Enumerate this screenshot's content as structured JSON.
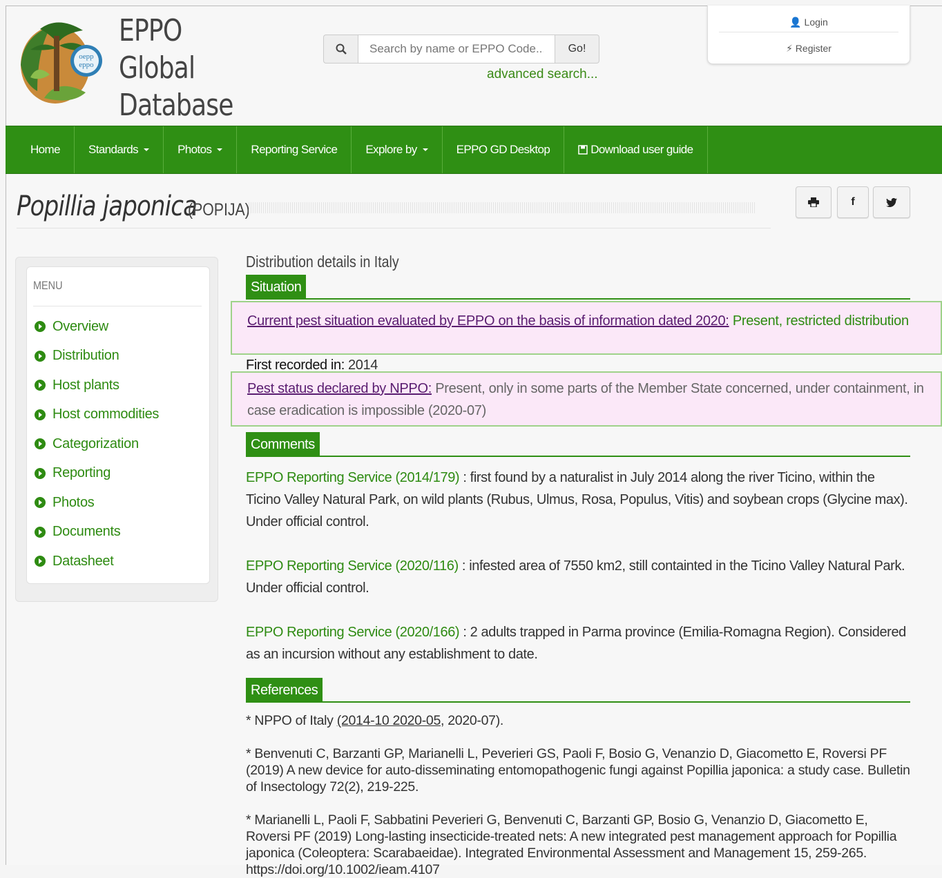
{
  "brand": {
    "line1": "EPPO",
    "line2": "Global",
    "line3": "Database",
    "logo_text_top": "oepp",
    "logo_text_bottom": "eppo"
  },
  "search": {
    "placeholder": "Search by name or EPPO Code...",
    "go_label": "Go!",
    "advanced_label": "advanced search..."
  },
  "user": {
    "login_label": "Login",
    "register_label": "Register"
  },
  "nav": [
    {
      "label": "Home",
      "dropdown": false
    },
    {
      "label": "Standards",
      "dropdown": true
    },
    {
      "label": "Photos",
      "dropdown": true
    },
    {
      "label": "Reporting Service",
      "dropdown": false
    },
    {
      "label": "Explore by",
      "dropdown": true
    },
    {
      "label": "EPPO GD Desktop",
      "dropdown": false
    },
    {
      "label": "Download user guide",
      "dropdown": false
    }
  ],
  "page": {
    "scientific_name": "Popillia japonica",
    "eppo_code": "(POPIJA)"
  },
  "menu": {
    "heading": "MENU",
    "items": [
      "Overview",
      "Distribution",
      "Host plants",
      "Host commodities",
      "Categorization",
      "Reporting",
      "Photos",
      "Documents",
      "Datasheet"
    ]
  },
  "distribution": {
    "title": "Distribution details in Italy",
    "situation_label": "Situation",
    "current_link": "Current pest situation evaluated by EPPO on the basis of information dated 2020:",
    "current_value": "Present, restricted distribution",
    "first_recorded_label": "First recorded in:",
    "first_recorded_value": "2014",
    "nppo_link": "Pest status declared by NPPO:",
    "nppo_value": "Present, only in some parts of the Member State concerned, under containment, in case eradication is impossible (2020-07)"
  },
  "comments": {
    "label": "Comments",
    "items": [
      {
        "link": "EPPO Reporting Service (2014/179)",
        "text": " : first found by a naturalist in July 2014 along the river Ticino, within the Ticino Valley Natural Park, on wild plants (Rubus, Ulmus, Rosa, Populus, Vitis) and soybean crops (Glycine max). Under official control."
      },
      {
        "link": "EPPO Reporting Service (2020/116)",
        "text": " : infested area of 7550 km2, still containted in the Ticino Valley Natural Park. Under official control."
      },
      {
        "link": "EPPO Reporting Service (2020/166)",
        "text": " : 2 adults trapped in Parma province (Emilia-Romagna Region). Considered as an incursion without any establishment to date."
      }
    ]
  },
  "references": {
    "label": "References",
    "r1_prefix": "* NPPO of Italy ",
    "r1_link": "(2014-10 2020-05",
    "r1_suffix": ", 2020-07).",
    "r2": "* Benvenuti C, Barzanti GP, Marianelli L, Peverieri GS, Paoli F, Bosio G, Venanzio D, Giacometto E, Roversi PF (2019) A new device for auto-disseminating entomopathogenic fungi against Popillia japonica: a study case. Bulletin of Insectology 72(2), 219-225.",
    "r3": "* Marianelli L, Paoli F, Sabbatini Peverieri G, Benvenuti C, Barzanti GP, Bosio G, Venanzio D, Giacometto E, Roversi PF (2019) Long-lasting insecticide-treated nets: A new integrated pest management approach for Popillia japonica (Coleoptera: Scarabaeidae). Integrated Environmental Assessment and Management 15, 259-265. https://doi.org/10.1002/ieam.4107"
  },
  "colors": {
    "green": "#2f8f14",
    "pink": "#fbe8f8",
    "link_purple": "#5a1c70"
  }
}
